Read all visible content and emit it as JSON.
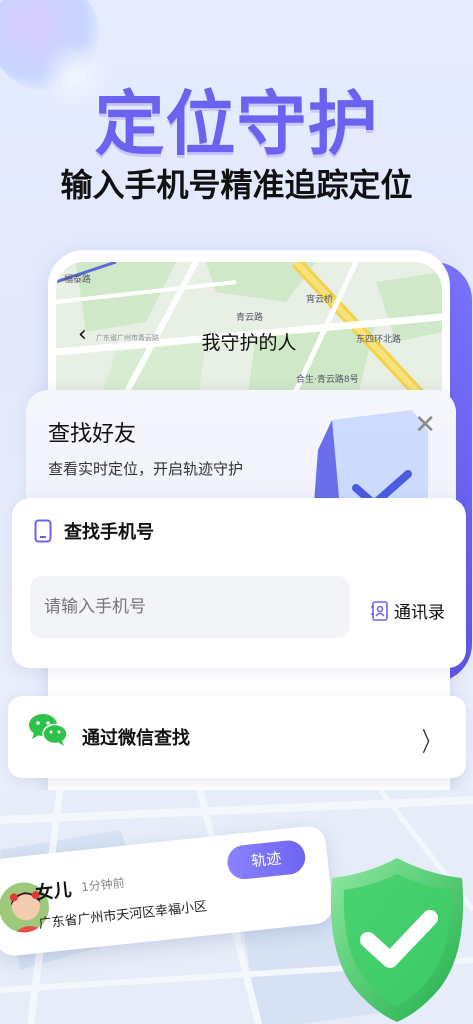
{
  "hero": {
    "title": "定位守护",
    "subtitle": "输入手机号精准追踪定位"
  },
  "map_header": {
    "back_icon": "chevron-left-icon",
    "title": "我守护的人",
    "street_labels": [
      "福泰路",
      "青云路",
      "宵云桥",
      "东四环北路",
      "合生·青云路8号",
      "广东省广州市青云路"
    ]
  },
  "find_friend": {
    "title": "查找好友",
    "description": "查看实时定位，开启轨迹守护",
    "close_icon": "close-icon"
  },
  "phone_search": {
    "icon": "phone-icon",
    "label": "查找手机号",
    "input_placeholder": "请输入手机号",
    "input_value": "",
    "contacts_icon": "contacts-icon",
    "contacts_label": "通讯录"
  },
  "wechat": {
    "icon": "wechat-icon",
    "label": "通过微信查找",
    "chevron_icon": "chevron-right-icon"
  },
  "person": {
    "name": "女儿",
    "time": "1分钟前",
    "address": "广东省广州市天河区幸福小区",
    "track_label": "轨迹"
  },
  "colors": {
    "accent": "#6b63f0",
    "wechat_green": "#2fc24a",
    "shield_green": "#3fcf6a"
  }
}
